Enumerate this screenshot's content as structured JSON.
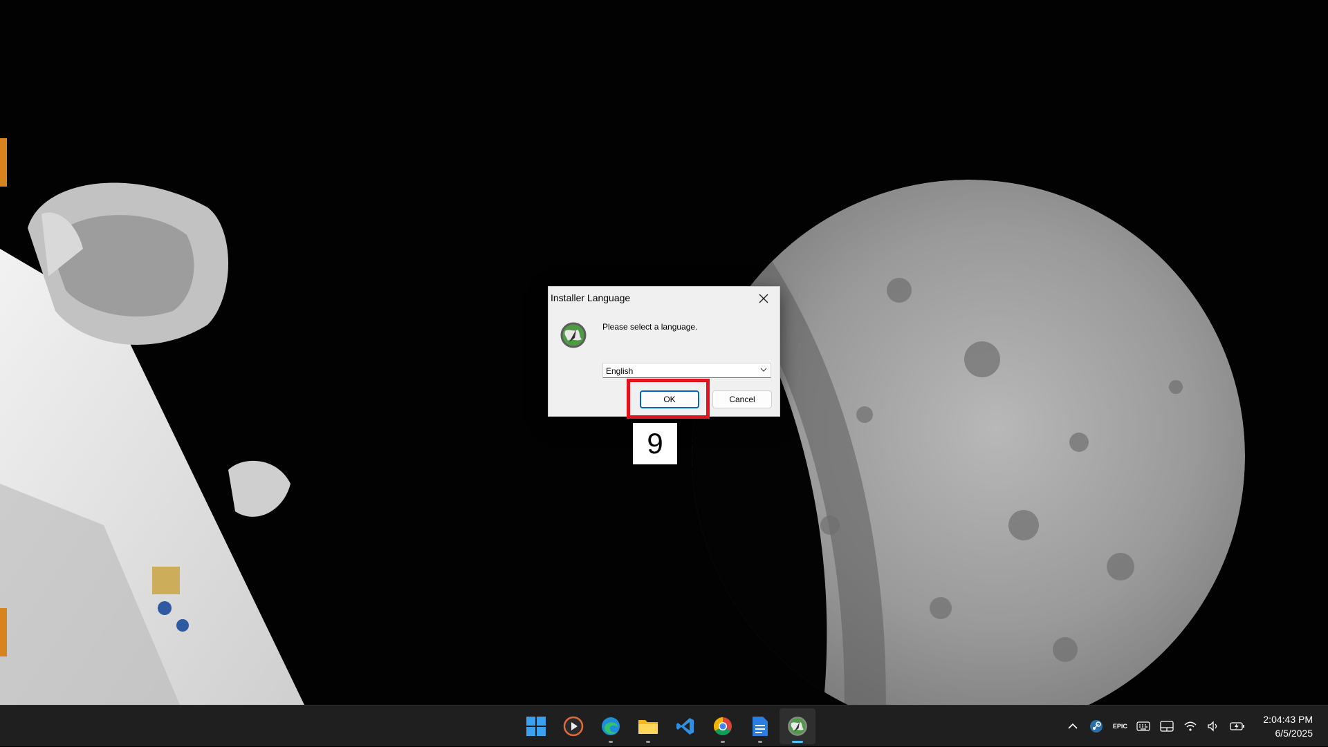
{
  "dialog": {
    "title": "Installer Language",
    "prompt": "Please select a language.",
    "language_selected": "English",
    "ok_label": "OK",
    "cancel_label": "Cancel",
    "icon": "installer-globe-icon"
  },
  "annotation": {
    "step_number": "9",
    "highlight_color": "#e0141e"
  },
  "taskbar": {
    "apps": [
      {
        "name": "start-button",
        "icon": "windows-logo-icon"
      },
      {
        "name": "media-player",
        "icon": "media-player-icon"
      },
      {
        "name": "edge",
        "icon": "edge-icon"
      },
      {
        "name": "file-explorer",
        "icon": "folder-icon"
      },
      {
        "name": "vscode",
        "icon": "vscode-icon"
      },
      {
        "name": "chrome",
        "icon": "chrome-icon"
      },
      {
        "name": "docs",
        "icon": "document-icon"
      },
      {
        "name": "installer",
        "icon": "installer-globe-icon"
      }
    ],
    "tray": {
      "epic_label": "EPIC",
      "time": "2:04:43 PM",
      "date": "6/5/2025"
    }
  },
  "colors": {
    "accent": "#0067c0",
    "taskbar_bg": "#1f1f1f",
    "active_indicator": "#4cc2ff"
  }
}
